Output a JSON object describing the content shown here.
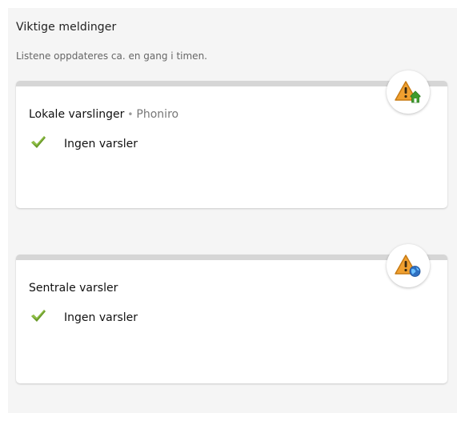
{
  "header": {
    "title": "Viktige meldinger",
    "subtitle": "Listene oppdateres ca. en gang i timen."
  },
  "local_alerts": {
    "title": "Lokale varslinger",
    "separator": "•",
    "organization": "Phoniro",
    "status_text": "Ingen varsler",
    "icon": "warning-home-icon"
  },
  "central_alerts": {
    "title": "Sentrale varsler",
    "status_text": "Ingen varsler",
    "icon": "warning-globe-icon"
  },
  "colors": {
    "panel_bg": "#f5f5f5",
    "card_top_bar": "#d6d6d6",
    "warning_orange": "#f0a030",
    "check_green": "#6a9a2a",
    "home_green": "#3f9b2f",
    "globe_blue": "#2f6fc0"
  }
}
